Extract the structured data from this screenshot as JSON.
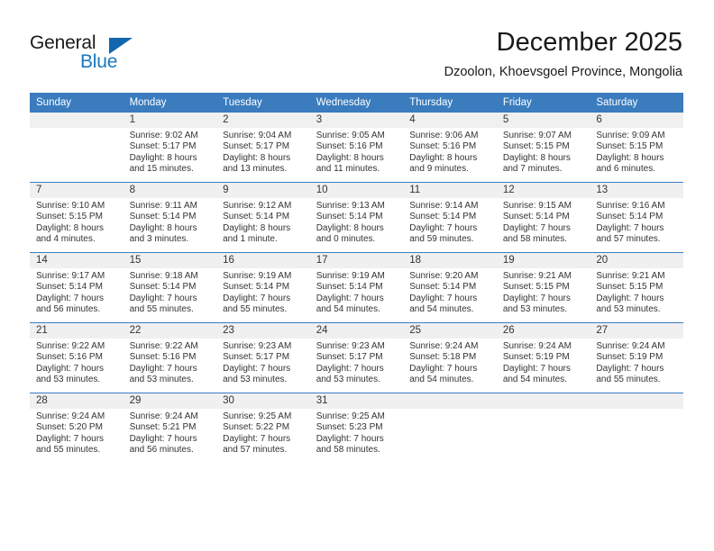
{
  "logo": {
    "word1": "General",
    "word2": "Blue",
    "triangle_color": "#1166ad",
    "blue_color": "#1878be"
  },
  "header": {
    "title": "December 2025",
    "subtitle": "Dzoolon, Khoevsgoel Province, Mongolia"
  },
  "theme": {
    "header_bg": "#3a7cbe",
    "header_text": "#ffffff",
    "daynum_bg": "#f0f0f0",
    "cell_text": "#333333",
    "divider": "#3a7cbe"
  },
  "weekday_headers": [
    "Sunday",
    "Monday",
    "Tuesday",
    "Wednesday",
    "Thursday",
    "Friday",
    "Saturday"
  ],
  "labels": {
    "sunrise_prefix": "Sunrise:",
    "sunset_prefix": "Sunset:",
    "daylight_prefix": "Daylight:"
  },
  "weeks": [
    [
      {
        "day": "",
        "sunrise": "",
        "sunset": "",
        "daylight_line1": "",
        "daylight_line2": ""
      },
      {
        "day": "1",
        "sunrise": "Sunrise: 9:02 AM",
        "sunset": "Sunset: 5:17 PM",
        "daylight_line1": "Daylight: 8 hours",
        "daylight_line2": "and 15 minutes."
      },
      {
        "day": "2",
        "sunrise": "Sunrise: 9:04 AM",
        "sunset": "Sunset: 5:17 PM",
        "daylight_line1": "Daylight: 8 hours",
        "daylight_line2": "and 13 minutes."
      },
      {
        "day": "3",
        "sunrise": "Sunrise: 9:05 AM",
        "sunset": "Sunset: 5:16 PM",
        "daylight_line1": "Daylight: 8 hours",
        "daylight_line2": "and 11 minutes."
      },
      {
        "day": "4",
        "sunrise": "Sunrise: 9:06 AM",
        "sunset": "Sunset: 5:16 PM",
        "daylight_line1": "Daylight: 8 hours",
        "daylight_line2": "and 9 minutes."
      },
      {
        "day": "5",
        "sunrise": "Sunrise: 9:07 AM",
        "sunset": "Sunset: 5:15 PM",
        "daylight_line1": "Daylight: 8 hours",
        "daylight_line2": "and 7 minutes."
      },
      {
        "day": "6",
        "sunrise": "Sunrise: 9:09 AM",
        "sunset": "Sunset: 5:15 PM",
        "daylight_line1": "Daylight: 8 hours",
        "daylight_line2": "and 6 minutes."
      }
    ],
    [
      {
        "day": "7",
        "sunrise": "Sunrise: 9:10 AM",
        "sunset": "Sunset: 5:15 PM",
        "daylight_line1": "Daylight: 8 hours",
        "daylight_line2": "and 4 minutes."
      },
      {
        "day": "8",
        "sunrise": "Sunrise: 9:11 AM",
        "sunset": "Sunset: 5:14 PM",
        "daylight_line1": "Daylight: 8 hours",
        "daylight_line2": "and 3 minutes."
      },
      {
        "day": "9",
        "sunrise": "Sunrise: 9:12 AM",
        "sunset": "Sunset: 5:14 PM",
        "daylight_line1": "Daylight: 8 hours",
        "daylight_line2": "and 1 minute."
      },
      {
        "day": "10",
        "sunrise": "Sunrise: 9:13 AM",
        "sunset": "Sunset: 5:14 PM",
        "daylight_line1": "Daylight: 8 hours",
        "daylight_line2": "and 0 minutes."
      },
      {
        "day": "11",
        "sunrise": "Sunrise: 9:14 AM",
        "sunset": "Sunset: 5:14 PM",
        "daylight_line1": "Daylight: 7 hours",
        "daylight_line2": "and 59 minutes."
      },
      {
        "day": "12",
        "sunrise": "Sunrise: 9:15 AM",
        "sunset": "Sunset: 5:14 PM",
        "daylight_line1": "Daylight: 7 hours",
        "daylight_line2": "and 58 minutes."
      },
      {
        "day": "13",
        "sunrise": "Sunrise: 9:16 AM",
        "sunset": "Sunset: 5:14 PM",
        "daylight_line1": "Daylight: 7 hours",
        "daylight_line2": "and 57 minutes."
      }
    ],
    [
      {
        "day": "14",
        "sunrise": "Sunrise: 9:17 AM",
        "sunset": "Sunset: 5:14 PM",
        "daylight_line1": "Daylight: 7 hours",
        "daylight_line2": "and 56 minutes."
      },
      {
        "day": "15",
        "sunrise": "Sunrise: 9:18 AM",
        "sunset": "Sunset: 5:14 PM",
        "daylight_line1": "Daylight: 7 hours",
        "daylight_line2": "and 55 minutes."
      },
      {
        "day": "16",
        "sunrise": "Sunrise: 9:19 AM",
        "sunset": "Sunset: 5:14 PM",
        "daylight_line1": "Daylight: 7 hours",
        "daylight_line2": "and 55 minutes."
      },
      {
        "day": "17",
        "sunrise": "Sunrise: 9:19 AM",
        "sunset": "Sunset: 5:14 PM",
        "daylight_line1": "Daylight: 7 hours",
        "daylight_line2": "and 54 minutes."
      },
      {
        "day": "18",
        "sunrise": "Sunrise: 9:20 AM",
        "sunset": "Sunset: 5:14 PM",
        "daylight_line1": "Daylight: 7 hours",
        "daylight_line2": "and 54 minutes."
      },
      {
        "day": "19",
        "sunrise": "Sunrise: 9:21 AM",
        "sunset": "Sunset: 5:15 PM",
        "daylight_line1": "Daylight: 7 hours",
        "daylight_line2": "and 53 minutes."
      },
      {
        "day": "20",
        "sunrise": "Sunrise: 9:21 AM",
        "sunset": "Sunset: 5:15 PM",
        "daylight_line1": "Daylight: 7 hours",
        "daylight_line2": "and 53 minutes."
      }
    ],
    [
      {
        "day": "21",
        "sunrise": "Sunrise: 9:22 AM",
        "sunset": "Sunset: 5:16 PM",
        "daylight_line1": "Daylight: 7 hours",
        "daylight_line2": "and 53 minutes."
      },
      {
        "day": "22",
        "sunrise": "Sunrise: 9:22 AM",
        "sunset": "Sunset: 5:16 PM",
        "daylight_line1": "Daylight: 7 hours",
        "daylight_line2": "and 53 minutes."
      },
      {
        "day": "23",
        "sunrise": "Sunrise: 9:23 AM",
        "sunset": "Sunset: 5:17 PM",
        "daylight_line1": "Daylight: 7 hours",
        "daylight_line2": "and 53 minutes."
      },
      {
        "day": "24",
        "sunrise": "Sunrise: 9:23 AM",
        "sunset": "Sunset: 5:17 PM",
        "daylight_line1": "Daylight: 7 hours",
        "daylight_line2": "and 53 minutes."
      },
      {
        "day": "25",
        "sunrise": "Sunrise: 9:24 AM",
        "sunset": "Sunset: 5:18 PM",
        "daylight_line1": "Daylight: 7 hours",
        "daylight_line2": "and 54 minutes."
      },
      {
        "day": "26",
        "sunrise": "Sunrise: 9:24 AM",
        "sunset": "Sunset: 5:19 PM",
        "daylight_line1": "Daylight: 7 hours",
        "daylight_line2": "and 54 minutes."
      },
      {
        "day": "27",
        "sunrise": "Sunrise: 9:24 AM",
        "sunset": "Sunset: 5:19 PM",
        "daylight_line1": "Daylight: 7 hours",
        "daylight_line2": "and 55 minutes."
      }
    ],
    [
      {
        "day": "28",
        "sunrise": "Sunrise: 9:24 AM",
        "sunset": "Sunset: 5:20 PM",
        "daylight_line1": "Daylight: 7 hours",
        "daylight_line2": "and 55 minutes."
      },
      {
        "day": "29",
        "sunrise": "Sunrise: 9:24 AM",
        "sunset": "Sunset: 5:21 PM",
        "daylight_line1": "Daylight: 7 hours",
        "daylight_line2": "and 56 minutes."
      },
      {
        "day": "30",
        "sunrise": "Sunrise: 9:25 AM",
        "sunset": "Sunset: 5:22 PM",
        "daylight_line1": "Daylight: 7 hours",
        "daylight_line2": "and 57 minutes."
      },
      {
        "day": "31",
        "sunrise": "Sunrise: 9:25 AM",
        "sunset": "Sunset: 5:23 PM",
        "daylight_line1": "Daylight: 7 hours",
        "daylight_line2": "and 58 minutes."
      },
      {
        "day": "",
        "sunrise": "",
        "sunset": "",
        "daylight_line1": "",
        "daylight_line2": ""
      },
      {
        "day": "",
        "sunrise": "",
        "sunset": "",
        "daylight_line1": "",
        "daylight_line2": ""
      },
      {
        "day": "",
        "sunrise": "",
        "sunset": "",
        "daylight_line1": "",
        "daylight_line2": ""
      }
    ]
  ]
}
